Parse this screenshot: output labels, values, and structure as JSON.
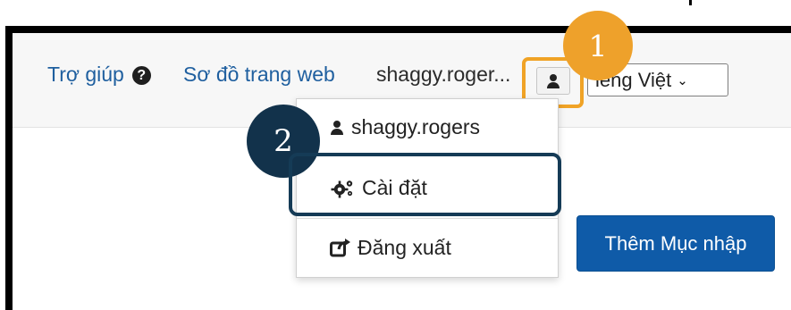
{
  "header": {
    "help_label": "Trợ giúp",
    "sitemap_label": "Sơ đồ trang web",
    "username_truncated": "shaggy.roger...",
    "language_value": "iếng Việt"
  },
  "dropdown": {
    "username": "shaggy.rogers",
    "settings_label": "Cài đặt",
    "logout_label": "Đăng xuất"
  },
  "main": {
    "add_entry_label": "Thêm Mục nhập"
  },
  "annotations": {
    "step_1": "1",
    "step_2": "2"
  },
  "colors": {
    "link": "#1f5f9f",
    "primary_button": "#0f5ba8",
    "highlight_orange": "#f0a326",
    "highlight_navy": "#153b56"
  },
  "icons": {
    "help": "question-circle-icon",
    "user": "user-icon",
    "settings": "cogs-icon",
    "logout": "share-out-icon",
    "chevron": "chevron-down-icon"
  }
}
